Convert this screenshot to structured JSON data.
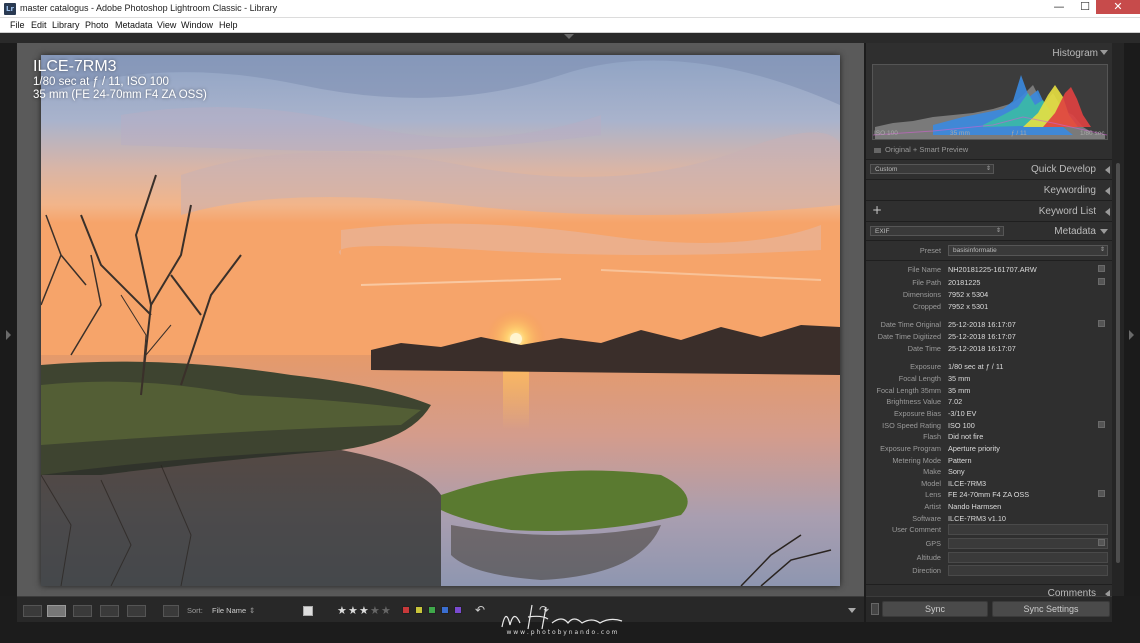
{
  "window": {
    "title": "master catalogus - Adobe Photoshop Lightroom Classic - Library",
    "minimize": "—",
    "maximize": "☐",
    "close": "✕"
  },
  "menu": [
    "File",
    "Edit",
    "Library",
    "Photo",
    "Metadata",
    "View",
    "Window",
    "Help"
  ],
  "overlay": {
    "camera": "ILCE-7RM3",
    "exposure": "1/80 sec at ƒ / 11, ISO 100",
    "lens": "35 mm (FE 24-70mm F4 ZA OSS)"
  },
  "histogram": {
    "title": "Histogram",
    "iso": "ISO 100",
    "focal": "35 mm",
    "aperture": "ƒ / 11",
    "shutter": "1/80 sec",
    "preview": "Original + Smart Preview"
  },
  "panels": {
    "quick_develop": "Quick Develop",
    "quick_develop_preset": "Custom",
    "keywording": "Keywording",
    "keyword_list": "Keyword List",
    "metadata": "Metadata",
    "metadata_mode": "EXIF",
    "comments": "Comments"
  },
  "preset": {
    "label": "Preset",
    "value": "basisinformatie"
  },
  "metadata": [
    {
      "k": "File Name",
      "v": "NH20181225-161707.ARW"
    },
    {
      "k": "File Path",
      "v": "20181225"
    },
    {
      "k": "Dimensions",
      "v": "7952 x 5304"
    },
    {
      "k": "Cropped",
      "v": "7952 x 5301"
    },
    {
      "k": "Date Time Original",
      "v": "25-12-2018 16:17:07"
    },
    {
      "k": "Date Time Digitized",
      "v": "25-12-2018 16:17:07"
    },
    {
      "k": "Date Time",
      "v": "25-12-2018 16:17:07"
    },
    {
      "k": "Exposure",
      "v": "1/80 sec at ƒ / 11"
    },
    {
      "k": "Focal Length",
      "v": "35 mm"
    },
    {
      "k": "Focal Length 35mm",
      "v": "35 mm"
    },
    {
      "k": "Brightness Value",
      "v": "7.02"
    },
    {
      "k": "Exposure Bias",
      "v": "-3/10 EV"
    },
    {
      "k": "ISO Speed Rating",
      "v": "ISO 100"
    },
    {
      "k": "Flash",
      "v": "Did not fire"
    },
    {
      "k": "Exposure Program",
      "v": "Aperture priority"
    },
    {
      "k": "Metering Mode",
      "v": "Pattern"
    },
    {
      "k": "Make",
      "v": "Sony"
    },
    {
      "k": "Model",
      "v": "ILCE-7RM3"
    },
    {
      "k": "Lens",
      "v": "FE 24-70mm F4 ZA OSS"
    },
    {
      "k": "Artist",
      "v": "Nando Harmsen"
    },
    {
      "k": "Software",
      "v": "ILCE-7RM3 v1.10"
    },
    {
      "k": "User Comment",
      "v": ""
    },
    {
      "k": "GPS",
      "v": ""
    },
    {
      "k": "Altitude",
      "v": ""
    },
    {
      "k": "Direction",
      "v": ""
    }
  ],
  "toolbar": {
    "sort_label": "Sort:",
    "sort_value": "File Name",
    "rating": 3,
    "rating_max": 5
  },
  "sync": {
    "sync": "Sync",
    "sync_settings": "Sync Settings"
  },
  "watermark": {
    "url": "w w w . p h o t o b y n a n d o . c o m"
  },
  "colors": {
    "red": "#c8393a",
    "yellow": "#c9c53a",
    "green": "#3fa84a",
    "blue": "#3a6ed0",
    "purple": "#7a4ad0"
  }
}
